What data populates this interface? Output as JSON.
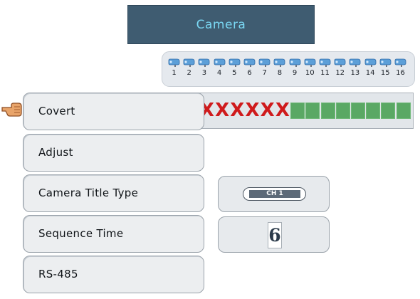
{
  "window": {
    "title": "Camera"
  },
  "channels": {
    "labels": [
      "1",
      "2",
      "3",
      "4",
      "5",
      "6",
      "7",
      "8",
      "9",
      "10",
      "11",
      "12",
      "13",
      "14",
      "15",
      "16"
    ],
    "icon": "camera-icon"
  },
  "covert_status": {
    "states": [
      "X",
      "X",
      "X",
      "X",
      "X",
      "X",
      "X",
      "X",
      "",
      "",
      "",
      "",
      "",
      "",
      "",
      ""
    ],
    "selected_index": 0,
    "colors": {
      "x_mark": "#cf1a1c",
      "enabled": "#5aa864",
      "selection": "#e0383a"
    }
  },
  "menu": {
    "pointer_icon": "hand-pointer-icon",
    "items": [
      {
        "label": "Covert"
      },
      {
        "label": "Adjust"
      },
      {
        "label": "Camera Title Type"
      },
      {
        "label": "Sequence Time"
      },
      {
        "label": "RS-485"
      }
    ],
    "selected_index": 0
  },
  "settings": {
    "camera_title_type_value": "CH 1",
    "sequence_time_value": "6"
  },
  "theme": {
    "title_bg": "#3f5c71",
    "title_text": "#7ad8f4",
    "panel_bg": "#eceef0"
  }
}
